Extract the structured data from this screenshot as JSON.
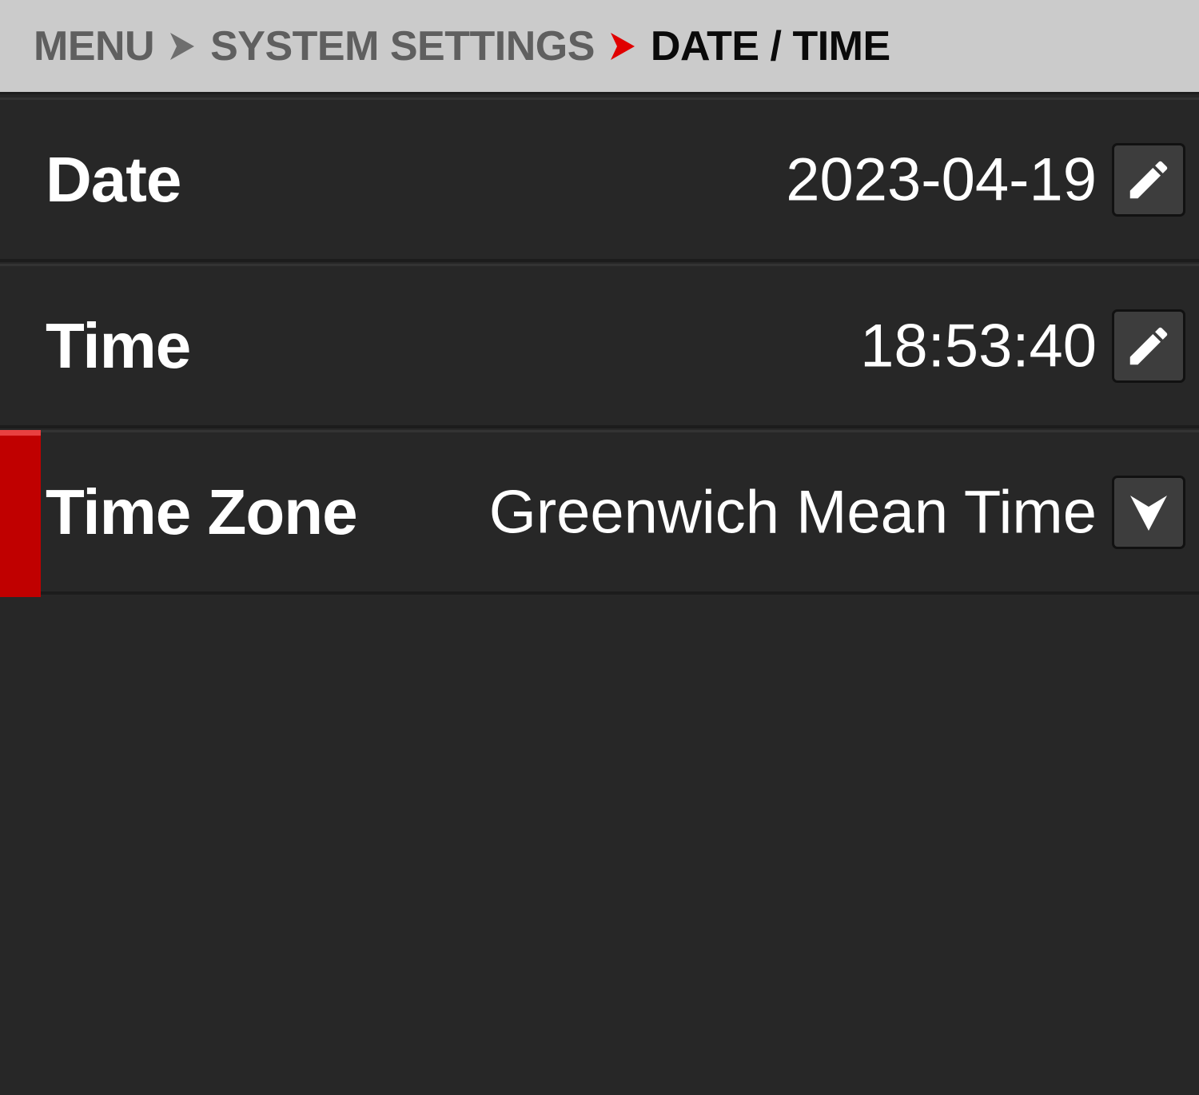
{
  "breadcrumb": {
    "items": [
      "MENU",
      "SYSTEM SETTINGS",
      "DATE / TIME"
    ],
    "separator_icon": "chevron-right-icon",
    "active_separator_color": "#e00000"
  },
  "settings": {
    "date": {
      "label": "Date",
      "value": "2023-04-19",
      "action_icon": "pencil-edit-icon"
    },
    "time": {
      "label": "Time",
      "value": "18:53:40",
      "action_icon": "pencil-edit-icon"
    },
    "timezone": {
      "label": "Time Zone",
      "value": "Greenwich Mean Time",
      "action_icon": "dropdown-arrow-icon",
      "selected": true
    }
  },
  "colors": {
    "background": "#272727",
    "header_background": "#cbcbcb",
    "selection_accent": "#c00000"
  }
}
